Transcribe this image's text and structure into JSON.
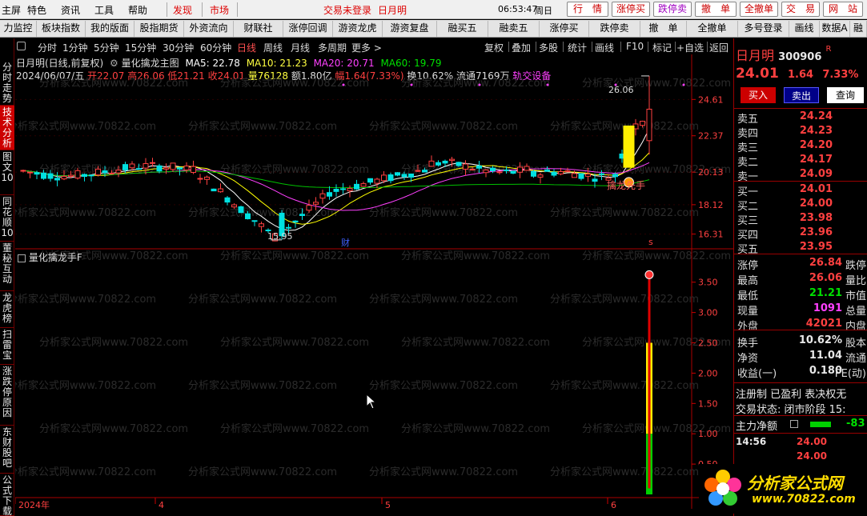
{
  "menu": {
    "items": [
      "主屏",
      "特色",
      "资讯",
      "工具",
      "帮助"
    ],
    "discover": "发现",
    "market": "市场",
    "login_status": "交易未登录",
    "user": "日月明",
    "clock": "06:53:47",
    "weekday": "周日",
    "quick_buttons": [
      "行　情",
      "涨停买",
      "跌停卖",
      "撤　单",
      "全撤单",
      "交　易",
      "网　站"
    ]
  },
  "toolbar": {
    "items": [
      "力监控",
      "板块指数",
      "我的版面",
      "股指期货",
      "外资流向",
      "财联社",
      "涨停回调",
      "游资龙虎",
      "游资复盘",
      "融买五",
      "融卖五",
      "涨停买",
      "跌停卖",
      "撤　单",
      "全撤单",
      "多号登录",
      "画线",
      "数据A",
      "融"
    ]
  },
  "left_tabs": [
    "分时走势",
    "技术分析",
    "图文10",
    "同花顺10",
    "董秘互动",
    "龙虎榜",
    "扫雷宝",
    "涨跌停原因",
    "东财股吧",
    "公式下载"
  ],
  "periods": [
    "分时",
    "1分钟",
    "5分钟",
    "15分钟",
    "30分钟",
    "60分钟",
    "日线",
    "周线",
    "月线",
    "多周期",
    "更多 >"
  ],
  "active_period": "日线",
  "chart_tools": [
    "复权",
    "叠加",
    "多股",
    "统计",
    "画线",
    "F10",
    "标记",
    "+自选",
    "返回"
  ],
  "header": {
    "stock": "日月明(日线,前复权)",
    "indicator": "量化擒龙主图",
    "ma5": "MA5: 22.78",
    "ma10": "MA10: 21.23",
    "ma20": "MA20: 20.71",
    "ma60": "MA60: 19.79",
    "date": "2024/06/07/五",
    "open": "开22.07",
    "high": "高26.06",
    "low": "低21.21",
    "close": "收24.01",
    "volume": "量76128",
    "amount": "额1.80亿",
    "change": "幅1.64(7.33%)",
    "turnover": "换10.62%",
    "float": "流通7169万",
    "sector": "轨交设备"
  },
  "main_chart": {
    "y_ticks": [
      "24.61",
      "22.37",
      "20.13",
      "18.12",
      "16.31"
    ],
    "high_label": "26.06",
    "low_label": "15.95",
    "signal_text": "擒龙先手",
    "finance_mark": "财",
    "s_mark": "s"
  },
  "sub_chart": {
    "title": "量化擒龙手F",
    "y_ticks": [
      "3.50",
      "3.00",
      "2.50",
      "2.00",
      "1.50",
      "1.00",
      "0.50"
    ]
  },
  "x_axis": [
    "2024年",
    "4",
    "5",
    "6"
  ],
  "quote": {
    "name": "日月明",
    "code": "300906",
    "r_mark": "R",
    "price": "24.01",
    "change": "1.64",
    "pct": "7.33%",
    "buttons": [
      "买入",
      "卖出",
      "查询"
    ],
    "asks": [
      {
        "label": "卖五",
        "price": "24.24"
      },
      {
        "label": "卖四",
        "price": "24.23"
      },
      {
        "label": "卖三",
        "price": "24.20"
      },
      {
        "label": "卖二",
        "price": "24.17"
      },
      {
        "label": "卖一",
        "price": "24.09"
      }
    ],
    "bids": [
      {
        "label": "买一",
        "price": "24.01"
      },
      {
        "label": "买二",
        "price": "24.00"
      },
      {
        "label": "买三",
        "price": "23.98"
      },
      {
        "label": "买四",
        "price": "23.96"
      },
      {
        "label": "买五",
        "price": "23.95"
      }
    ],
    "stats": [
      {
        "l": "涨停",
        "v": "26.84",
        "r": "跌停"
      },
      {
        "l": "最高",
        "v": "26.06",
        "r": "量比"
      },
      {
        "l": "最低",
        "v": "21.21",
        "r": "市值"
      },
      {
        "l": "现量",
        "v": "1091",
        "r": "总量"
      },
      {
        "l": "外盘",
        "v": "42021",
        "r": "内盘"
      }
    ],
    "stats2": [
      {
        "l": "换手",
        "v": "10.62%",
        "r": "股本"
      },
      {
        "l": "净资",
        "v": "11.04",
        "r": "流通"
      },
      {
        "l": "收益(一)",
        "v": "0.180",
        "r": "PE(动)"
      }
    ],
    "reg": "注册制 已盈利 表决权无",
    "trade_state": "交易状态: 闭市阶段 15:",
    "main_flow_label": "主力净额",
    "main_flow_value": "-83",
    "ticks": [
      {
        "t": "14:56",
        "p": "24.00"
      },
      {
        "t": "",
        "p": "24.00"
      }
    ]
  },
  "logo": {
    "name": "分析家公式网",
    "url": "www.70822.com"
  },
  "watermark": "分析家公式网www.70822.com",
  "colors": {
    "accent": "#cc0000",
    "up": "#ff4040",
    "down": "#00e0e0",
    "ma5": "#ffffff",
    "ma10": "#ffff00",
    "ma20": "#ff40ff",
    "ma60": "#00c000"
  },
  "chart_data": {
    "type": "candlestick",
    "series_ma": [
      "MA5",
      "MA10",
      "MA20",
      "MA60"
    ],
    "last_bar": {
      "open": 22.07,
      "high": 26.06,
      "low": 21.21,
      "close": 24.01
    },
    "period_low": 15.95,
    "period_high": 26.06,
    "price_ylim": [
      15.5,
      26.5
    ],
    "indicator_ylim": [
      0,
      3.8
    ],
    "indicator_last": {
      "green": 1.0,
      "yellow_top": 2.5,
      "red_top": 3.65
    }
  }
}
